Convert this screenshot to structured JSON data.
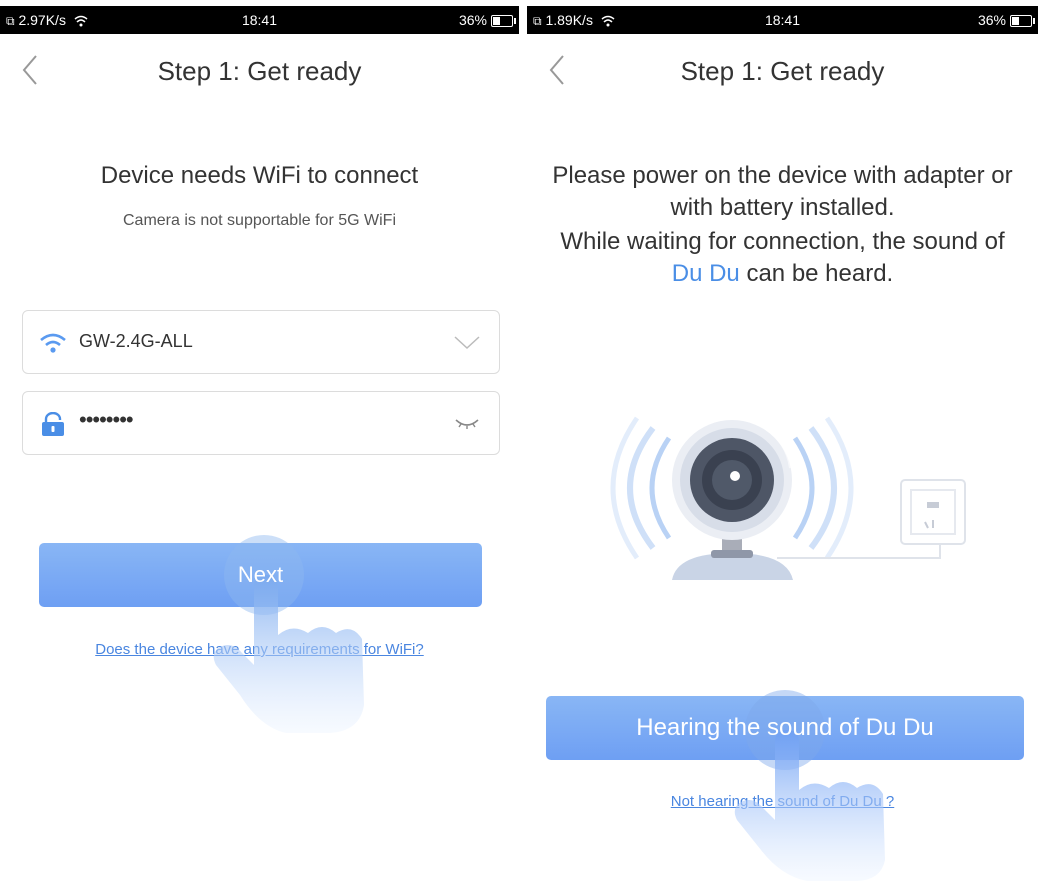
{
  "left_screen": {
    "status": {
      "speed": "2.97K/s",
      "time": "18:41",
      "battery": "36%"
    },
    "title": "Step 1: Get ready",
    "heading": "Device needs WiFi to connect",
    "subheading": "Camera is not supportable for 5G WiFi",
    "wifi_ssid": "GW-2.4G-ALL",
    "password_masked": "••••••••",
    "next_label": "Next",
    "help_link": "Does the device have any requirements for WiFi?",
    "icons": [
      "back-arrow-icon",
      "wifi-icon",
      "chevron-down-icon",
      "lock-icon",
      "eye-closed-icon",
      "hand-pointer-icon"
    ]
  },
  "right_screen": {
    "status": {
      "speed": "1.89K/s",
      "time": "18:41",
      "battery": "36%"
    },
    "title": "Step 1: Get ready",
    "instruction_line1": "Please power on the device with adapter or",
    "instruction_line2": "with battery installed.",
    "instruction_line3": "While waiting for connection, the sound of",
    "instruction_highlight": "Du Du",
    "instruction_end": " can be heard.",
    "confirm_label": "Hearing the sound of Du Du",
    "help_link": "Not hearing the sound of Du Du ?",
    "icons": [
      "back-arrow-icon",
      "camera-illustration",
      "power-socket-icon",
      "hand-pointer-icon"
    ]
  },
  "colors": {
    "accent": "#6e9ff3",
    "link": "#4a86e0",
    "highlight": "#4a8ee6"
  }
}
